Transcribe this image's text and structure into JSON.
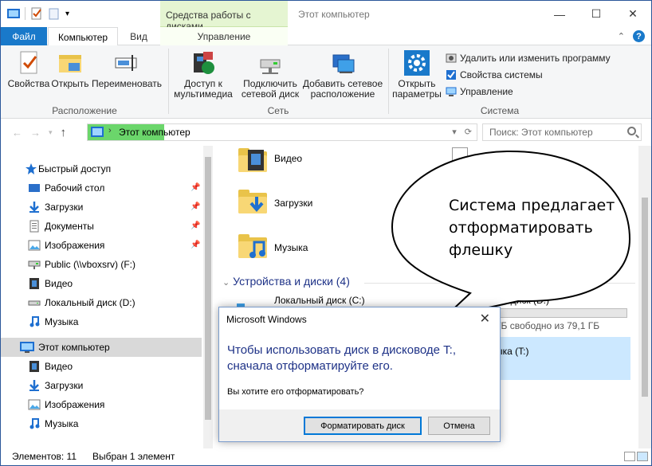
{
  "titlebar": {
    "context_tab": "Средства работы с дисками",
    "title": "Этот компьютер"
  },
  "tabs": {
    "file": "Файл",
    "computer": "Компьютер",
    "view": "Вид",
    "manage": "Управление"
  },
  "ribbon": {
    "buttons": [
      {
        "label": "Свойства",
        "icon": "properties-icon"
      },
      {
        "label": "Открыть",
        "icon": "open-icon"
      },
      {
        "label": "Переименовать",
        "icon": "rename-icon"
      },
      {
        "label": "Доступ к мультимедиа",
        "icon": "media-access-icon"
      },
      {
        "label": "Подключить сетевой диск",
        "icon": "map-network-drive-icon"
      },
      {
        "label": "Добавить сетевое расположение",
        "icon": "add-network-location-icon"
      },
      {
        "label": "Открыть параметры",
        "icon": "settings-icon"
      }
    ],
    "small": [
      {
        "label": "Удалить или изменить программу"
      },
      {
        "label": "Свойства системы"
      },
      {
        "label": "Управление"
      }
    ],
    "groups": [
      "Расположение",
      "Сеть",
      "Система"
    ]
  },
  "address": {
    "path": "Этот компьютер",
    "search_placeholder": "Поиск: Этот компьютер"
  },
  "nav": {
    "quick_access": "Быстрый доступ",
    "items": [
      "Рабочий стол",
      "Загрузки",
      "Документы",
      "Изображения",
      "Public (\\\\vboxsrv) (F:)",
      "Видео",
      "Локальный диск (D:)",
      "Музыка"
    ],
    "this_pc": "Этот компьютер",
    "pc_items": [
      "Видео",
      "Загрузки",
      "Изображения",
      "Музыка"
    ]
  },
  "content": {
    "folders": [
      "Видео",
      "Загрузки",
      "Музыка"
    ],
    "section": "Устройства и диски (4)",
    "drive_c": "Локальный диск (C:)",
    "drive_d": "ый диск (D:)",
    "drive_d_free": "ГБ свободно из 79,1 ГБ",
    "drive_d_used_fraction": 0.0,
    "drive_t": "ыка (T:)",
    "partial_top": "Д"
  },
  "status": {
    "items": "Элементов: 11",
    "selected": "Выбран 1 элемент"
  },
  "callout": {
    "lines": [
      "Система предлагает",
      "отформатировать",
      "флешку"
    ]
  },
  "dialog": {
    "title": "Microsoft Windows",
    "main": "Чтобы использовать диск в дисководе T:, сначала отформатируйте его.",
    "sub": "Вы хотите его отформатировать?",
    "format_button": "Форматировать диск",
    "cancel_button": "Отмена"
  },
  "colors": {
    "accent": "#1979ca",
    "context_green": "#e5f5d2",
    "dialog_text": "#1e3287",
    "address_highlight": "#6bd66b"
  }
}
